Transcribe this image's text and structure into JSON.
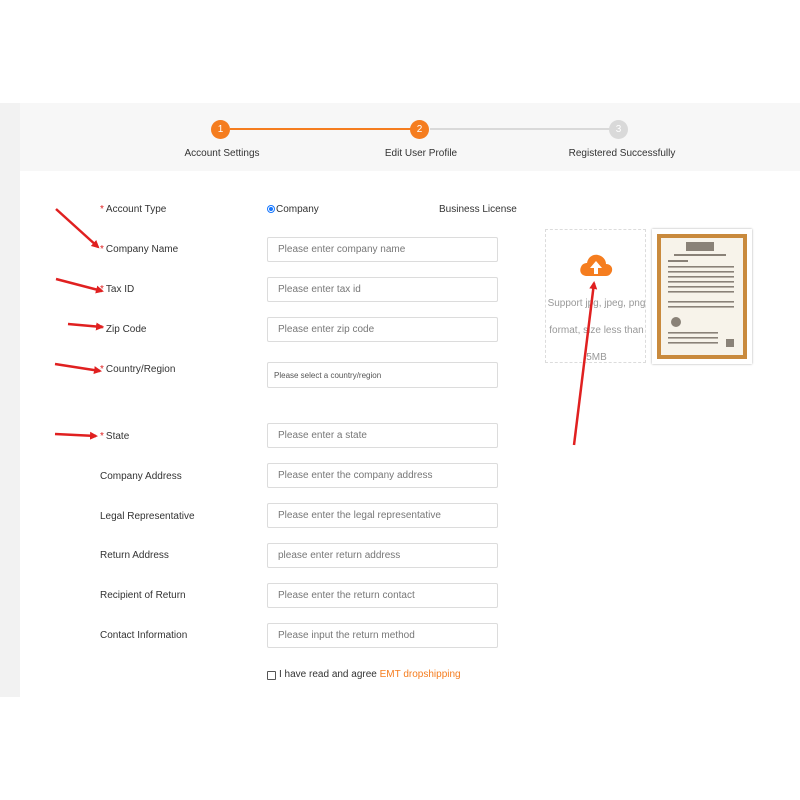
{
  "steps": [
    {
      "number": "1",
      "label": "Account Settings",
      "state": "done"
    },
    {
      "number": "2",
      "label": "Edit User Profile",
      "state": "active"
    },
    {
      "number": "3",
      "label": "Registered Successfully",
      "state": "pending"
    }
  ],
  "colors": {
    "accent": "#f57d1f",
    "pending": "#d9d9d9",
    "required": "#e02020",
    "annotation": "#e02020",
    "radio": "#1677ff"
  },
  "form": {
    "account_type": {
      "label": "Account Type",
      "required": true,
      "option": "Company",
      "selected": true
    },
    "business_license_label": "Business License",
    "fields": [
      {
        "key": "company_name",
        "label": "Company Name",
        "required": true,
        "placeholder": "Please enter company name",
        "value": ""
      },
      {
        "key": "tax_id",
        "label": "Tax ID",
        "required": true,
        "placeholder": "Please enter tax id",
        "value": ""
      },
      {
        "key": "zip_code",
        "label": "Zip Code",
        "required": true,
        "placeholder": "Please enter zip code",
        "value": ""
      },
      {
        "key": "country_region",
        "label": "Country/Region",
        "required": true,
        "placeholder": "Please select a country/region",
        "value": ""
      },
      {
        "key": "state",
        "label": "State",
        "required": true,
        "placeholder": "Please enter a state",
        "value": ""
      },
      {
        "key": "company_address",
        "label": "Company Address",
        "required": false,
        "placeholder": "Please enter the company address",
        "value": ""
      },
      {
        "key": "legal_representative",
        "label": "Legal Representative",
        "required": false,
        "placeholder": "Please enter the legal representative",
        "value": ""
      },
      {
        "key": "return_address",
        "label": "Return Address",
        "required": false,
        "placeholder": "please enter return address",
        "value": ""
      },
      {
        "key": "recipient_of_return",
        "label": "Recipient of Return",
        "required": false,
        "placeholder": "Please enter the return contact",
        "value": ""
      },
      {
        "key": "contact_information",
        "label": "Contact Information",
        "required": false,
        "placeholder": "Please input the return method",
        "value": ""
      }
    ],
    "upload": {
      "icon": "cloud-upload-icon",
      "hint": "Support jpg, jpeg, png format, size less than 5MB"
    },
    "agreement": {
      "text": "I have read and agree",
      "link": "EMT dropshipping",
      "checked": false
    }
  }
}
